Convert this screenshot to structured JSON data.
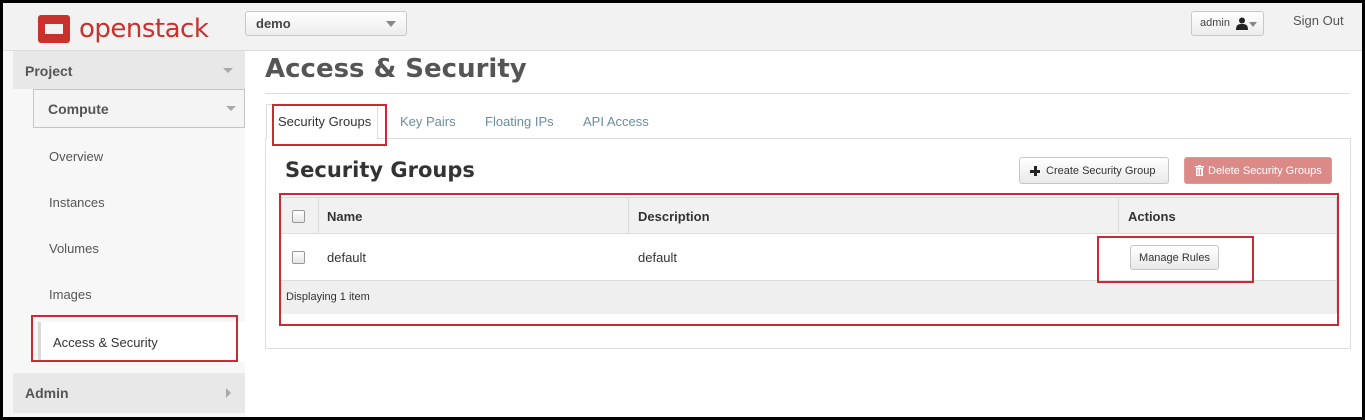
{
  "header": {
    "logo_text": "openstack",
    "project_select": "demo",
    "user_menu": "admin",
    "sign_out": "Sign Out"
  },
  "sidebar": {
    "project_label": "Project",
    "compute_label": "Compute",
    "items": [
      {
        "label": "Overview"
      },
      {
        "label": "Instances"
      },
      {
        "label": "Volumes"
      },
      {
        "label": "Images"
      },
      {
        "label": "Access & Security"
      }
    ],
    "admin_label": "Admin"
  },
  "main": {
    "page_title": "Access & Security",
    "tabs": [
      {
        "label": "Security Groups",
        "active": true
      },
      {
        "label": "Key Pairs",
        "active": false
      },
      {
        "label": "Floating IPs",
        "active": false
      },
      {
        "label": "API Access",
        "active": false
      }
    ],
    "section_title": "Security Groups",
    "create_button": "Create Security Group",
    "delete_button": "Delete Security Groups",
    "table": {
      "columns": [
        "Name",
        "Description",
        "Actions"
      ],
      "rows": [
        {
          "name": "default",
          "description": "default",
          "action": "Manage Rules"
        }
      ],
      "footer": "Displaying 1 item"
    }
  },
  "colors": {
    "brand_red": "#c9312c",
    "highlight_red": "#cc2a32",
    "tab_link": "#6a8da0",
    "delete_button": "#dc8a87"
  },
  "icons": [
    "openstack-logo-icon",
    "user-icon",
    "plus-icon",
    "trash-icon",
    "chevron-down-icon",
    "chevron-right-icon"
  ]
}
